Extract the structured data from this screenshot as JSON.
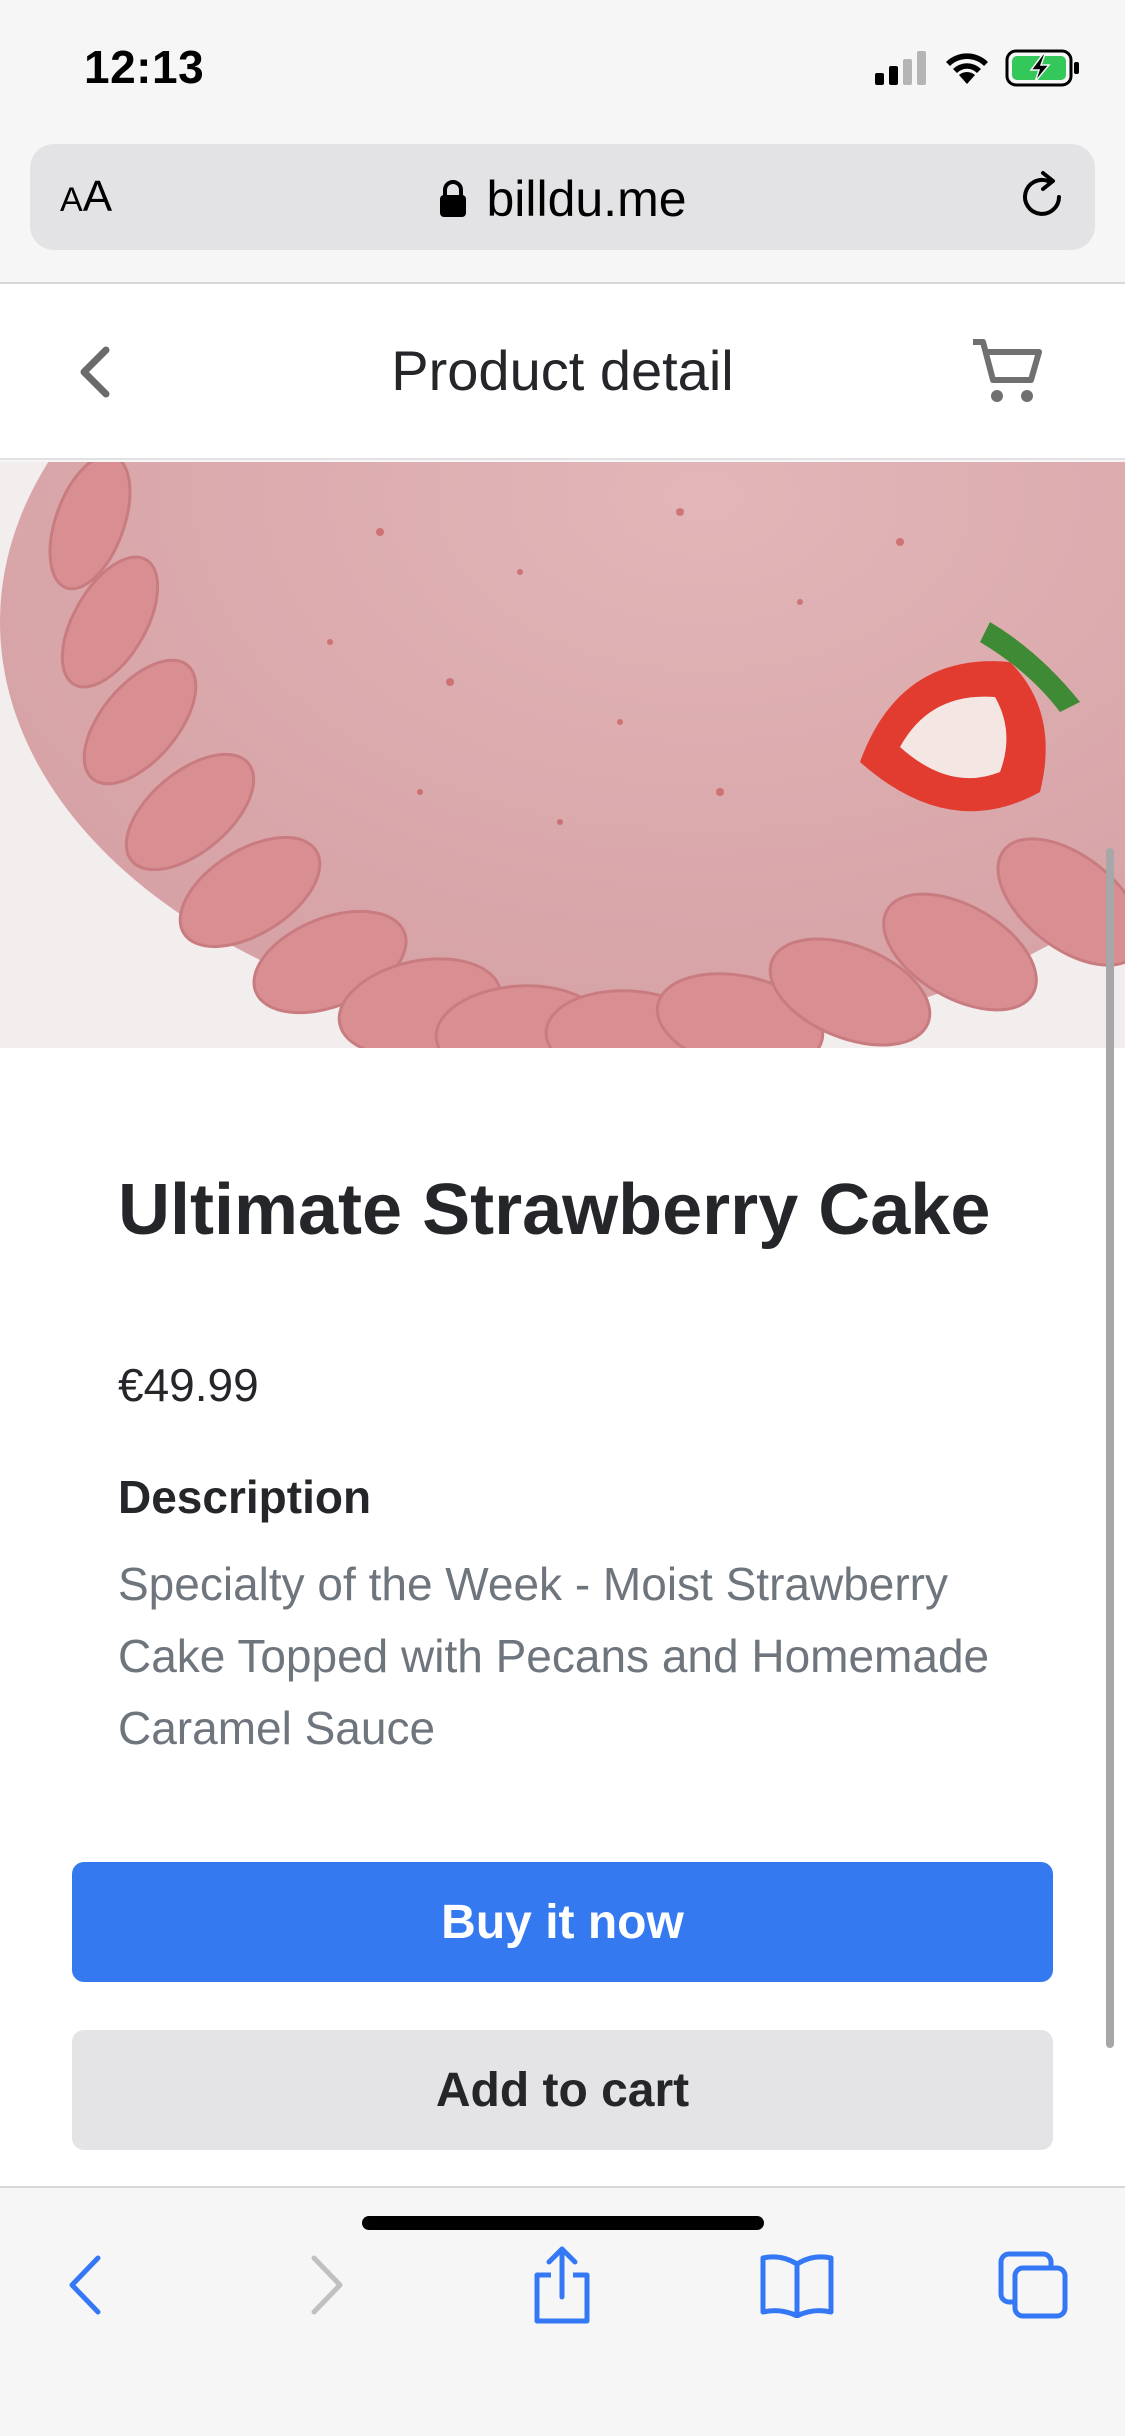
{
  "status_bar": {
    "time": "12:13"
  },
  "browser": {
    "aa_small": "A",
    "aa_big": "A",
    "url": "billdu.me"
  },
  "header": {
    "title": "Product detail"
  },
  "product": {
    "name": "Ultimate Strawberry Cake",
    "price": "€49.99",
    "description_heading": "Description",
    "description": "Specialty of the Week - Moist Strawberry Cake Topped with Pecans and Homemade Caramel Sauce"
  },
  "actions": {
    "buy_now": "Buy it now",
    "add_to_cart": "Add to cart"
  },
  "colors": {
    "primary": "#3479f0",
    "secondary_button": "#e4e4e6",
    "text": "#24262a",
    "muted_text": "#6e757d",
    "ios_blue": "#3478f6"
  },
  "icons": [
    "signal-icon",
    "wifi-icon",
    "battery-charging-icon",
    "lock-icon",
    "reload-icon",
    "back-arrow-icon",
    "cart-icon",
    "safari-back-icon",
    "safari-forward-icon",
    "share-icon",
    "bookmarks-icon",
    "tabs-icon"
  ]
}
